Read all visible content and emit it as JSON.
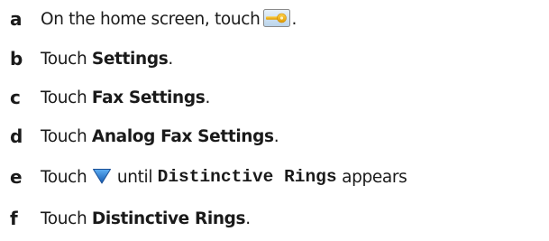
{
  "steps": [
    {
      "letter": "a",
      "pre": "On the home screen, touch",
      "icon": "settings-key-icon",
      "post": "."
    },
    {
      "letter": "b",
      "pre": "Touch ",
      "bold": "Settings",
      "post": "."
    },
    {
      "letter": "c",
      "pre": "Touch ",
      "bold": "Fax Settings",
      "post": "."
    },
    {
      "letter": "d",
      "pre": "Touch ",
      "bold": "Analog Fax Settings",
      "post": "."
    },
    {
      "letter": "e",
      "pre": "Touch ",
      "icon": "down-arrow-icon",
      "mid": "until ",
      "mono": "Distinctive Rings",
      "post": " appears"
    },
    {
      "letter": "f",
      "pre": "Touch ",
      "bold": "Distinctive Rings",
      "post": "."
    }
  ],
  "colors": {
    "text": "#1a1a1a",
    "key_icon_frame": "#8a8a8a",
    "key_icon_background": "#cfe3f3",
    "key_icon_key": "#f2a900",
    "down_arrow": "#1f73c8"
  }
}
